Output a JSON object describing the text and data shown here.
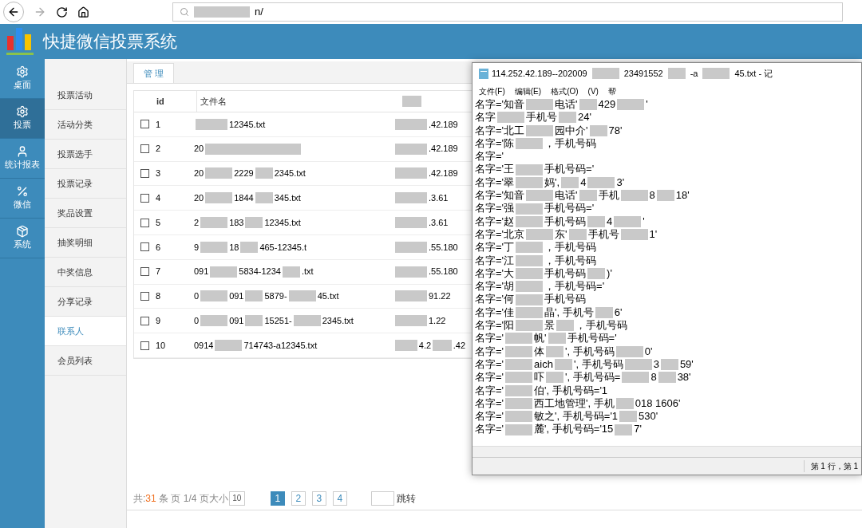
{
  "browser": {
    "address": "n/"
  },
  "app": {
    "title": "快捷微信投票系统"
  },
  "nav": [
    {
      "label": "桌面",
      "selected": false
    },
    {
      "label": "投票",
      "selected": true
    },
    {
      "label": "统计报表",
      "selected": false
    },
    {
      "label": "微信",
      "selected": false
    },
    {
      "label": "系统",
      "selected": false
    }
  ],
  "submenu": [
    {
      "label": "投票活动",
      "selected": false
    },
    {
      "label": "活动分类",
      "selected": false
    },
    {
      "label": "投票选手",
      "selected": false
    },
    {
      "label": "投票记录",
      "selected": false
    },
    {
      "label": "奖品设置",
      "selected": false
    },
    {
      "label": "抽奖明细",
      "selected": false
    },
    {
      "label": "中奖信息",
      "selected": false
    },
    {
      "label": "分享记录",
      "selected": false
    },
    {
      "label": "联系人",
      "selected": true
    },
    {
      "label": "会员列表",
      "selected": false
    }
  ],
  "tabs": [
    {
      "label": "管 理",
      "selected": true
    }
  ],
  "table": {
    "columns": [
      "id",
      "文件名"
    ],
    "rows": [
      {
        "checked": false,
        "id": "1",
        "file": {
          "lead": true,
          "parts": [
            "12345.txt"
          ]
        },
        "ip": {
          "lead": true,
          "parts": [
            ".42.189"
          ]
        }
      },
      {
        "checked": false,
        "id": "2",
        "file": {
          "trail": true,
          "parts": [
            "20"
          ]
        },
        "ip": {
          "lead": true,
          "parts": [
            ".42.189"
          ]
        }
      },
      {
        "checked": false,
        "id": "3",
        "file": {
          "parts": [
            "20",
            "2229",
            "2345.txt"
          ]
        },
        "ip": {
          "lead": true,
          "parts": [
            ".42.189"
          ]
        }
      },
      {
        "checked": false,
        "id": "4",
        "file": {
          "parts": [
            "20",
            "1844",
            "345.txt"
          ]
        },
        "ip": {
          "lead": true,
          "parts": [
            ".3.61"
          ]
        }
      },
      {
        "checked": false,
        "id": "5",
        "file": {
          "parts": [
            "2",
            "183",
            "12345.txt"
          ]
        },
        "ip": {
          "lead": true,
          "parts": [
            ".3.61"
          ]
        }
      },
      {
        "checked": false,
        "id": "6",
        "file": {
          "parts": [
            "9",
            "18",
            "465-12345.t"
          ]
        },
        "ip": {
          "lead": true,
          "parts": [
            ".55.180"
          ]
        }
      },
      {
        "checked": false,
        "id": "7",
        "file": {
          "parts": [
            "091",
            "5834-1234",
            ".txt"
          ]
        },
        "ip": {
          "lead": true,
          "parts": [
            ".55.180"
          ]
        }
      },
      {
        "checked": false,
        "id": "8",
        "file": {
          "parts": [
            "0",
            "091",
            "5879-",
            "45.txt"
          ]
        },
        "ip": {
          "lead": true,
          "parts": [
            "91.22"
          ]
        }
      },
      {
        "checked": false,
        "id": "9",
        "file": {
          "parts": [
            "0",
            "091",
            "15251-",
            "2345.txt"
          ]
        },
        "ip": {
          "lead": true,
          "parts": [
            "1.22"
          ]
        }
      },
      {
        "checked": false,
        "id": "10",
        "file": {
          "parts": [
            "0914",
            "714743-a12345.txt"
          ]
        },
        "ip": {
          "lead": true,
          "parts": [
            "4.2",
            ".42"
          ]
        }
      }
    ]
  },
  "pagination": {
    "total_prefix": "共:",
    "total": "31",
    "total_suffix": "条 页 1/4 页大小",
    "page_size": "10",
    "pages": [
      {
        "label": "1",
        "selected": true
      },
      {
        "label": "2",
        "selected": false
      },
      {
        "label": "3",
        "selected": false
      },
      {
        "label": "4",
        "selected": false
      }
    ],
    "jump": "跳转"
  },
  "notepad": {
    "title": [
      "114.252.42.189--202009",
      "23491552",
      "-a",
      "45.txt - 记"
    ],
    "menu": [
      "文件(F)",
      "编辑(E)",
      "格式(O)",
      "(V)",
      "帮"
    ],
    "lines": [
      [
        "名字='知音",
        "电话'",
        "429",
        "'"
      ],
      [
        "名字",
        "手机号",
        "24'"
      ],
      [
        "名字='北工",
        "园中介'",
        "78'"
      ],
      [
        "名字='陈",
        "，手机号码"
      ],
      [
        "名字='"
      ],
      [
        "名字='王",
        "手机号码='"
      ],
      [
        "名字='翠",
        "妈',",
        "4",
        "3'"
      ],
      [
        "名字='知音",
        "电话'",
        "手机",
        "8",
        "18'"
      ],
      [
        "名字='强",
        "手机号码='"
      ],
      [
        "名字='赵",
        "手机号码",
        "4",
        "'"
      ],
      [
        "名字='北京",
        "东'",
        "手机号",
        "1'"
      ],
      [
        "名字='丁",
        "，手机号码"
      ],
      [
        "名字='江",
        "，手机号码"
      ],
      [
        "名字='大",
        "手机号码",
        ")'"
      ],
      [
        "名字='胡",
        "，手机号码='"
      ],
      [
        "名字='何",
        "手机号码"
      ],
      [
        "名字='佳",
        "晶', 手机号",
        "6'"
      ],
      [
        "名字='阳",
        "景",
        "，手机号码"
      ],
      [
        "名字='",
        "帆'",
        "手机号码='"
      ],
      [
        "名字='",
        "体",
        "', 手机号码",
        "0'"
      ],
      [
        "名字='",
        "aich",
        "', 手机号码",
        "3",
        "59'"
      ],
      [
        "名字='",
        "吓",
        "', 手机号码=",
        "8",
        "38'"
      ],
      [
        "名字='",
        "伯', 手机号码='1"
      ],
      [
        "名字='",
        "西工地管理', 手机",
        "018 1606'"
      ],
      [
        "名字='",
        "敏之', 手机号码='1",
        "530'"
      ],
      [
        "名字='",
        "麓', 手机号码='15",
        "7'"
      ]
    ],
    "status": "第 1 行，第 1"
  }
}
